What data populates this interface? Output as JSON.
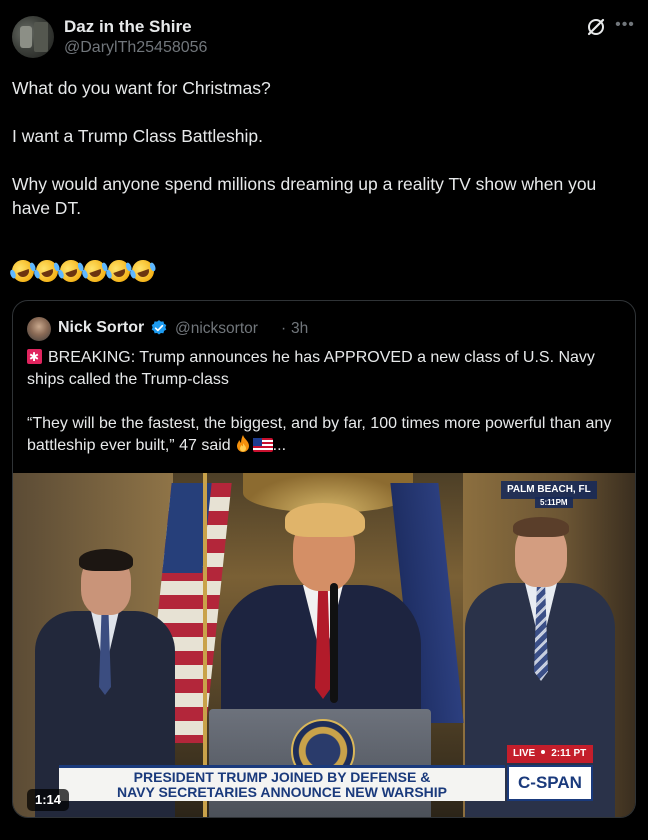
{
  "post": {
    "author": {
      "display_name": "Daz in the Shire",
      "handle": "@DarylTh25458056",
      "avatar": "avatar"
    },
    "icons": {
      "grok": "grok-icon",
      "more": "more-icon"
    },
    "text_lines": [
      "What do you want for Christmas?",
      "",
      "I want a Trump Class Battleship.",
      "",
      "Why would anyone spend millions dreaming up a reality TV show when you have DT.",
      ""
    ],
    "emoji": {
      "name": "rolling-on-floor-laughing-icon",
      "count": 6
    }
  },
  "quote": {
    "author": {
      "display_name": "Nick Sortor",
      "handle": "@nicksortor",
      "separator": "·",
      "time": "3h",
      "verified": true
    },
    "text": {
      "line1": "BREAKING: Trump announces he has APPROVED a new class of U.S. Navy ships called the Trump-class",
      "line2": "“They will be the fastest, the biggest, and by far, 100 times more powerful than any battleship ever built,” 47 said",
      "line2_suffix": "..."
    },
    "video": {
      "location": "PALM BEACH, FL",
      "location_time": "5:11PM",
      "live_label": "LIVE",
      "live_time": "2:11 PT",
      "chyron_line1": "PRESIDENT TRUMP JOINED BY DEFENSE &",
      "chyron_line2": "NAVY SECRETARIES ANNOUNCE NEW WARSHIP",
      "network": "C-SPAN",
      "duration": "1:14"
    }
  },
  "colors": {
    "background": "#000000",
    "text": "#e7e9ea",
    "secondary": "#71767b",
    "verified": "#1d9bf0",
    "border": "#2f3336"
  }
}
